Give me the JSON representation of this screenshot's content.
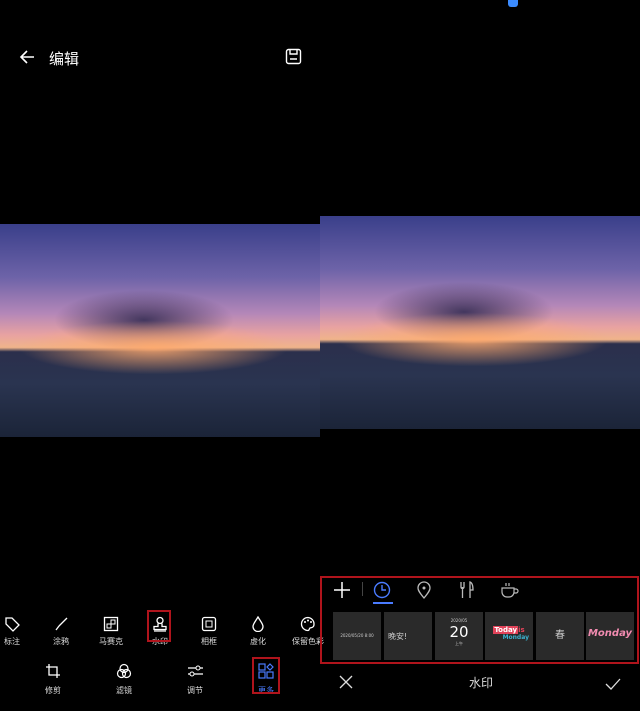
{
  "left": {
    "title": "编辑",
    "tools_row1": [
      "标注",
      "涂鸦",
      "马赛克",
      "水印",
      "相框",
      "虚化",
      "保留色彩"
    ],
    "tools_row2": [
      "修剪",
      "滤镜",
      "调节",
      "更多"
    ]
  },
  "right": {
    "title": "水印",
    "thumbs": {
      "t1": "2020/05/20 8:00",
      "t2a": "晚安!",
      "t3a": "2020/05",
      "t3b": "20",
      "t3c": "上午",
      "t4a": "Today",
      "t4b": "is",
      "t4c": "Monday",
      "t5": "春",
      "t6": "Monday"
    }
  },
  "colors": {
    "accent": "#4a7bff",
    "highlight": "#b0141c"
  }
}
